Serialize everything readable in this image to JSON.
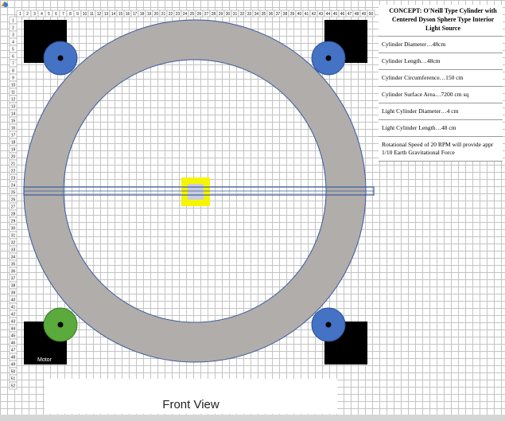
{
  "ruler": {
    "columns": [
      "1",
      "2",
      "3",
      "4",
      "5",
      "6",
      "7",
      "8",
      "9",
      "10",
      "11",
      "12",
      "13",
      "14",
      "15",
      "16",
      "17",
      "18",
      "19",
      "20",
      "21",
      "22",
      "23",
      "24",
      "25",
      "26",
      "27",
      "28",
      "29",
      "30",
      "31",
      "32",
      "33",
      "34",
      "35",
      "36",
      "37",
      "38",
      "39",
      "40",
      "41",
      "42",
      "43",
      "44",
      "45",
      "46",
      "47",
      "48",
      "49",
      "50"
    ],
    "rows": [
      "1",
      "2",
      "3",
      "4",
      "5",
      "6",
      "7",
      "8",
      "9",
      "10",
      "11",
      "12",
      "13",
      "14",
      "15",
      "16",
      "17",
      "18",
      "19",
      "20",
      "21",
      "22",
      "23",
      "24",
      "25",
      "26",
      "27",
      "28",
      "29",
      "30",
      "31",
      "32",
      "33",
      "34",
      "35",
      "36",
      "37",
      "38",
      "39",
      "40",
      "41",
      "42",
      "43",
      "44",
      "45",
      "46",
      "47",
      "48",
      "49",
      "50",
      "51",
      "52"
    ]
  },
  "diagram": {
    "motor_label": "Motor",
    "caption": "Front View"
  },
  "colors": {
    "cylinder_ring": "#b0adab",
    "outline": "#3a5a9c",
    "roller_blue": "#4472c4",
    "roller_green": "#5aaa3c",
    "corner_block": "#000000",
    "light_source": "#f5f500",
    "light_core": "#c9cddf"
  },
  "notes": {
    "title": "CONCEPT:  O'Neill Type Cylinder with Centered Dyson Sphere Type Interior Light Source",
    "items": [
      "Cylinder Diameter…48cm",
      "Cylinder Length…48cm",
      "Cylinder Circumference…150 cm",
      "Cylinder Surface Area…7200 cm sq",
      "Light Cylinder Diameter…4 cm",
      "Light Cylinder Length…48 cm",
      "Rotational Speed of 20 RPM will provide appr 1/10 Earth Gravitational Force"
    ]
  }
}
